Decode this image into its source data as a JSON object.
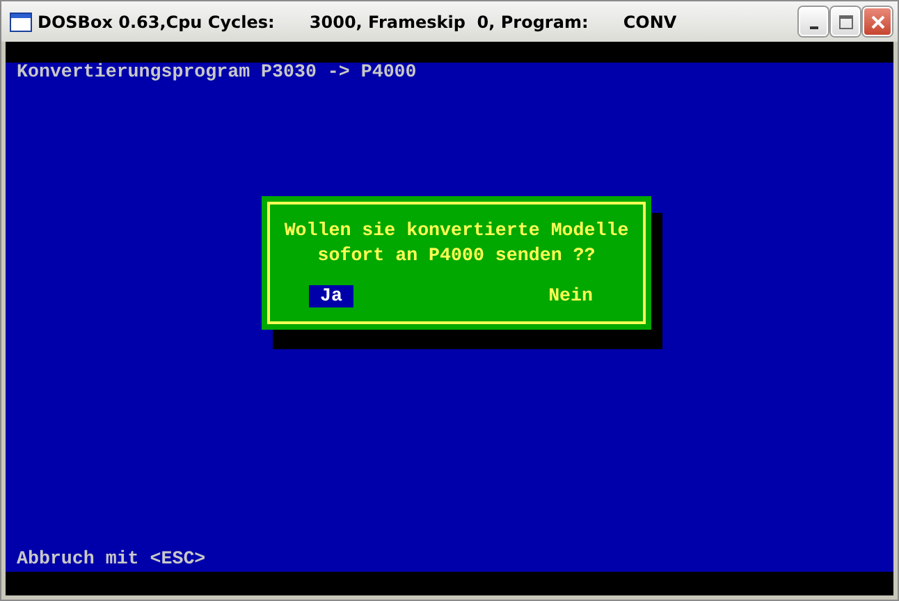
{
  "window": {
    "title": "DOSBox 0.63,Cpu Cycles:      3000, Frameskip  0, Program:      CONV"
  },
  "header": "Konvertierungsprogram P3030 -> P4000",
  "dialog": {
    "lines": [
      "Wollen sie konvertierte Modelle",
      "sofort an P4000 senden ??"
    ],
    "buttons": [
      {
        "label": "Ja",
        "selected": true
      },
      {
        "label": "Nein",
        "selected": false
      }
    ]
  },
  "footer": "Abbruch mit <ESC>"
}
